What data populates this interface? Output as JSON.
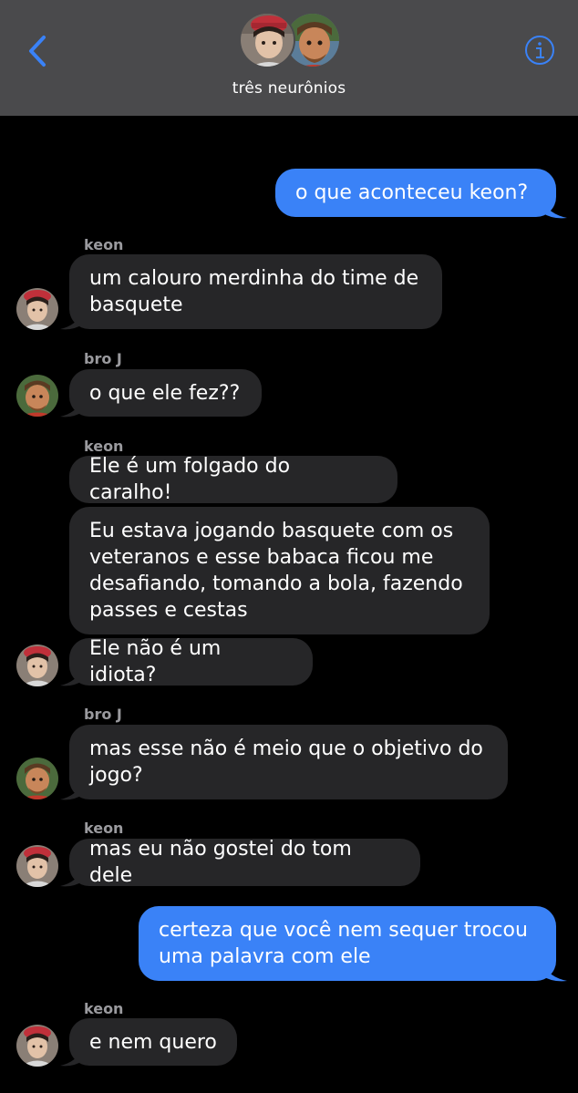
{
  "header": {
    "group_name": "três neurônios",
    "back_icon": "chevron-left-icon",
    "info_icon": "info-icon",
    "accent": "#3a82f7"
  },
  "messages": [
    {
      "direction": "out",
      "text": "o que aconteceu keon?"
    },
    {
      "direction": "in",
      "sender": "keon",
      "text": "um calouro merdinha do time de\nbasquete"
    },
    {
      "direction": "in",
      "sender": "bro J",
      "text": "o que ele fez??"
    },
    {
      "direction": "in",
      "sender": "keon",
      "text": "Ele é um folgado do caralho!"
    },
    {
      "direction": "in",
      "text": "Eu estava jogando basquete com os\nveteranos e esse babaca ficou me\ndesafiando, tomando a bola, fazendo\npasses e cestas"
    },
    {
      "direction": "in",
      "text": "Ele não é um idiota?"
    },
    {
      "direction": "in",
      "sender": "bro J",
      "text": "mas esse não é meio que o objetivo do\njogo?"
    },
    {
      "direction": "in",
      "sender": "keon",
      "text": "mas eu não gostei do tom dele"
    },
    {
      "direction": "out",
      "text": "certeza que você nem sequer trocou\numa palavra com ele"
    },
    {
      "direction": "in",
      "sender": "keon",
      "text": "e nem quero"
    }
  ],
  "colors": {
    "incoming_bubble": "#262628",
    "outgoing_bubble": "#3a82f7",
    "header_bg": "#4a4a4c",
    "sender_label": "#9a9a9e"
  }
}
